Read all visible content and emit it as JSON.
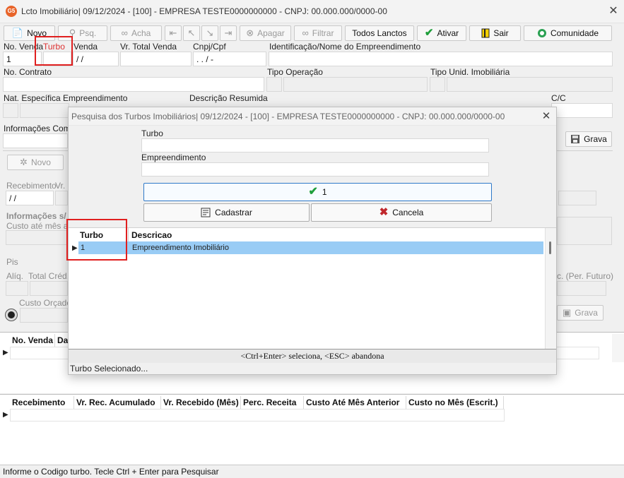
{
  "window": {
    "title": "Lcto Imobiliário|  09/12/2024 - [100] - EMPRESA TESTE0000000000 - CNPJ: 00.000.000/0000-00",
    "icon_text": "G5"
  },
  "toolbar": {
    "novo": "Novo",
    "psq": "Psq.",
    "acha": "Acha",
    "apagar": "Apagar",
    "filtrar": "Filtrar",
    "todos_lanctos": "Todos Lanctos",
    "ativar": "Ativar",
    "sair": "Sair",
    "comunidade": "Comunidade"
  },
  "form": {
    "no_venda_label": "No. Venda",
    "no_venda_value": "1",
    "turbo_label": "Turbo",
    "venda_label": "Venda",
    "venda_value": "/ /",
    "vr_total_venda_label": "Vr. Total Venda",
    "cnpj_label": "Cnpj/Cpf",
    "cnpj_value": ".   .   /   -",
    "identificacao_label": "Identificação/Nome do Empreendimento",
    "no_contrato_label": "No. Contrato",
    "tipo_operacao_label": "Tipo Operação",
    "tipo_unid_label": "Tipo Unid. Imobiliária",
    "nat_especifica_label": "Nat. Específica Empreendimento",
    "descricao_resumida_label": "Descrição Resumida",
    "cc_label": "C/C",
    "info_compl_label": "Informações Compl",
    "grava_label": "Grava"
  },
  "background_panel": {
    "novo_label": "Novo",
    "recebimento_label": "Recebimento",
    "vr_label": "Vr.",
    "recebimento_value": "/ /",
    "informacoes_label": "Informações s/",
    "custo_ate_label": "Custo até mês an",
    "pis_label": "Pis",
    "aliq_label": "Alíq.",
    "total_cred_label": "Total Créd.",
    "custo_orcado_label": "Custo Orçado",
    "per_futuro_label": "c. (Per. Futuro)",
    "grava_label": "Grava"
  },
  "dialog": {
    "title": "Pesquisa dos Turbos Imobiliários|  09/12/2024 - [100] - EMPRESA TESTE0000000000 - CNPJ: 00.000.000/0000-00",
    "turbo_label": "Turbo",
    "empreendimento_label": "Empreendimento",
    "select_button": "1",
    "cadastrar_button": "Cadastrar",
    "cancela_button": "Cancela",
    "grid": {
      "columns": [
        "Turbo",
        "Descricao"
      ],
      "rows": [
        {
          "turbo": "1",
          "descricao": "Empreendimento Imobiliário"
        }
      ]
    },
    "footer_hint": "<Ctrl+Enter> seleciona, <ESC> abandona",
    "status": "Turbo Selecionado..."
  },
  "grid1": {
    "columns": [
      "No. Venda",
      "Da"
    ]
  },
  "grid2": {
    "columns": [
      "Recebimento",
      "Vr. Rec. Acumulado",
      "Vr. Recebido (Mês)",
      "Perc. Receita",
      "Custo Até Mês Anterior",
      "Custo no Mês (Escrit.)"
    ]
  },
  "statusbar": {
    "text": "Informe o Codigo turbo. Tecle Ctrl + Enter para Pesquisar"
  },
  "colors": {
    "highlight_box": "#e01f1f",
    "selected_row": "#99ccf5",
    "turbo_label": "#d33",
    "check_green": "#1e9e3a",
    "cancel_red": "#c0282d"
  }
}
